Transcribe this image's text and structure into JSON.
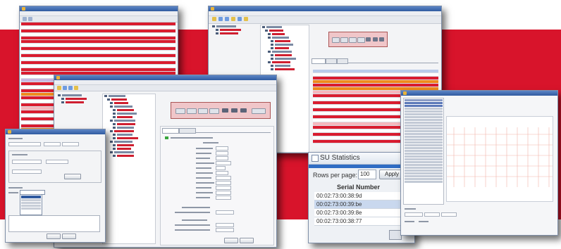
{
  "stats_panel": {
    "title": "SU Statistics",
    "rows_label": "Rows per page:",
    "rows_value": "100",
    "apply_label": "Apply",
    "column_header": "Serial Number",
    "serials": [
      "00:02:73:00:38:9d",
      "00:02:73:00:39:be",
      "00:02:73:00:39:8e",
      "00:02:73:00:38:77"
    ]
  },
  "colors": {
    "brand_red": "#d8142b",
    "row_red": "#d91c2f",
    "row_orange": "#f08a1c",
    "title_blue": "#2f5aa0"
  }
}
